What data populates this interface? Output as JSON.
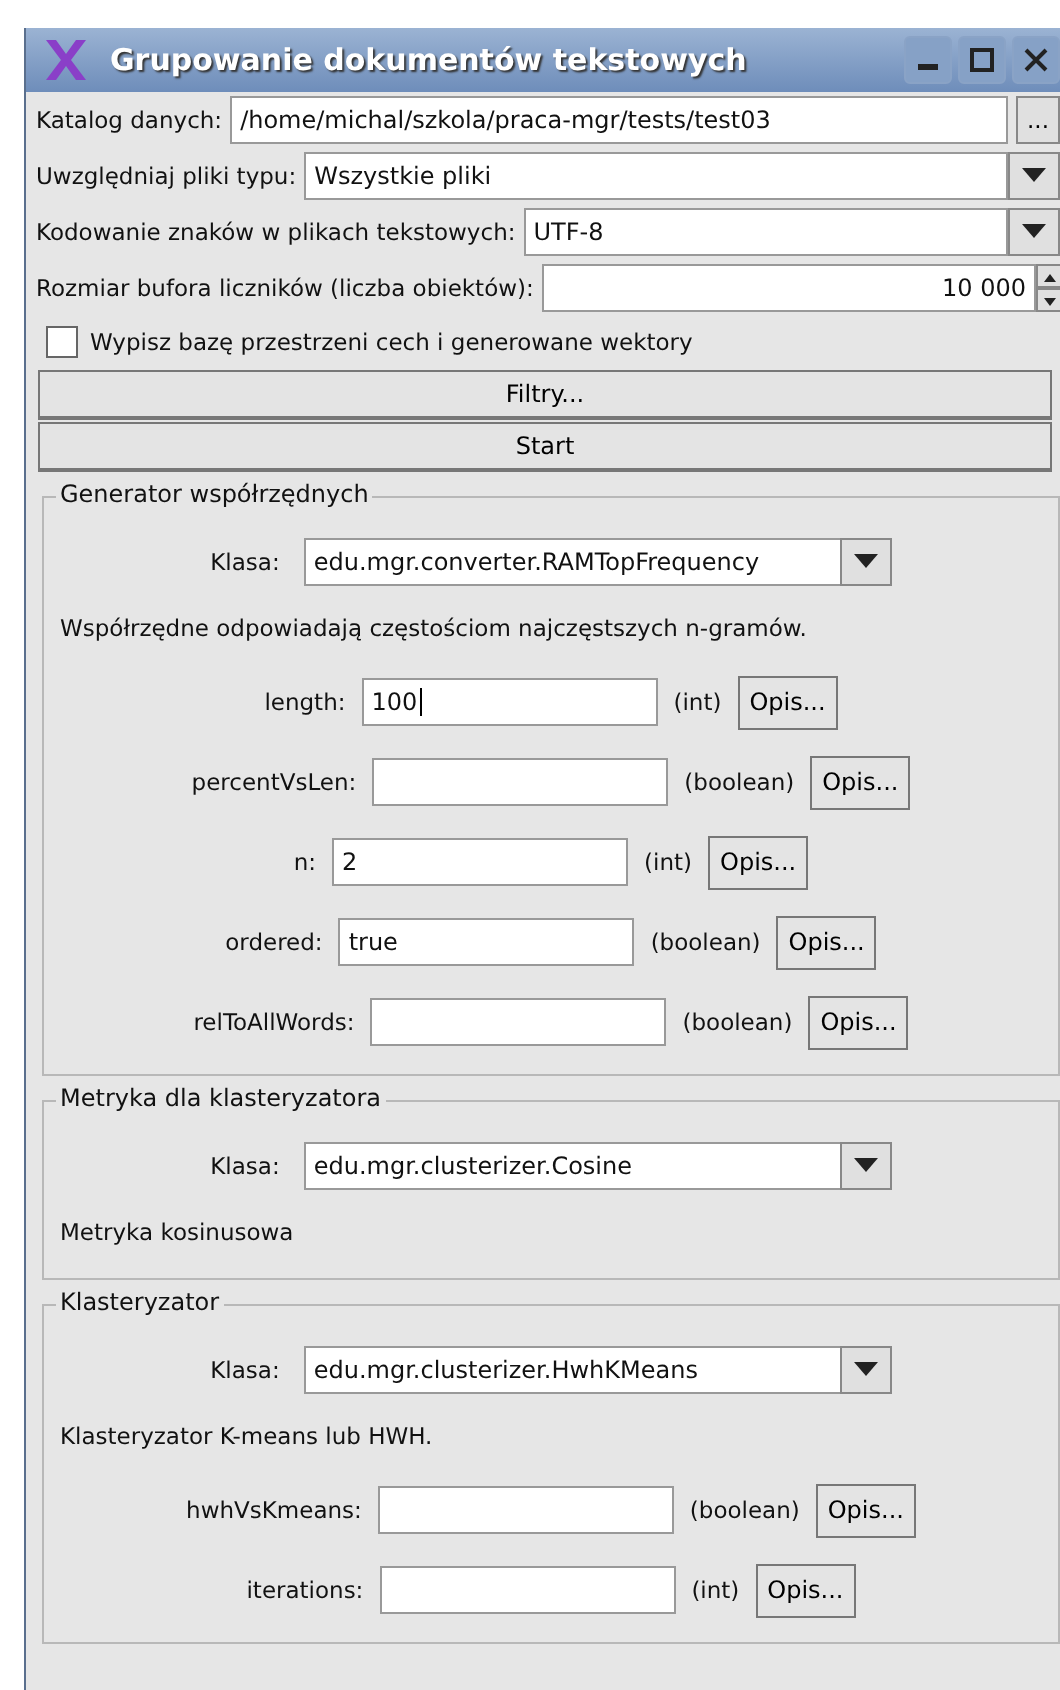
{
  "window": {
    "title": "Grupowanie dokumentów tekstowych"
  },
  "data_dir": {
    "label": "Katalog danych:",
    "value": "/home/michal/szkola/praca-mgr/tests/test03",
    "browse_button": "..."
  },
  "file_type": {
    "label": "Uwzględniaj pliki typu:",
    "value": "Wszystkie pliki"
  },
  "encoding": {
    "label": "Kodowanie znaków w plikach tekstowych:",
    "value": "UTF-8"
  },
  "buffer_size": {
    "label": "Rozmiar bufora liczników (liczba obiektów):",
    "value": "10 000"
  },
  "print_option": {
    "label": "Wypisz bazę przestrzeni cech i generowane wektory",
    "checked": false
  },
  "buttons": [
    "Filtry...",
    "Start"
  ],
  "groups": [
    {
      "title": "Generator współrzędnych",
      "class_label": "Klasa:",
      "class_value": "edu.mgr.converter.RAMTopFrequency",
      "description": "Współrzędne odpowiadają częstościom najczęstszych n-gramów.",
      "params": [
        {
          "name": "length:",
          "value": "100",
          "focused": true,
          "type": "(int)",
          "button": "Opis..."
        },
        {
          "name": "percentVsLen:",
          "focused": false,
          "type": "(boolean)",
          "button": "Opis..."
        },
        {
          "name": "n:",
          "value": "2",
          "focused": false,
          "type": "(int)",
          "button": "Opis..."
        },
        {
          "name": "ordered:",
          "value": "true",
          "focused": false,
          "type": "(boolean)",
          "button": "Opis..."
        },
        {
          "name": "relToAllWords:",
          "focused": false,
          "type": "(boolean)",
          "button": "Opis..."
        }
      ]
    },
    {
      "title": "Metryka dla klasteryzatora",
      "class_label": "Klasa:",
      "class_value": "edu.mgr.clusterizer.Cosine",
      "description": "Metryka kosinusowa"
    },
    {
      "title": "Klasteryzator",
      "class_label": "Klasa:",
      "class_value": "edu.mgr.clusterizer.HwhKMeans",
      "description": "Klasteryzator K-means lub HWH.",
      "params": [
        {
          "name": "hwhVsKmeans:",
          "focused": false,
          "type": "(boolean)",
          "button": "Opis..."
        },
        {
          "name": "iterations:",
          "focused": false,
          "type": "(int)",
          "button": "Opis..."
        }
      ]
    }
  ]
}
